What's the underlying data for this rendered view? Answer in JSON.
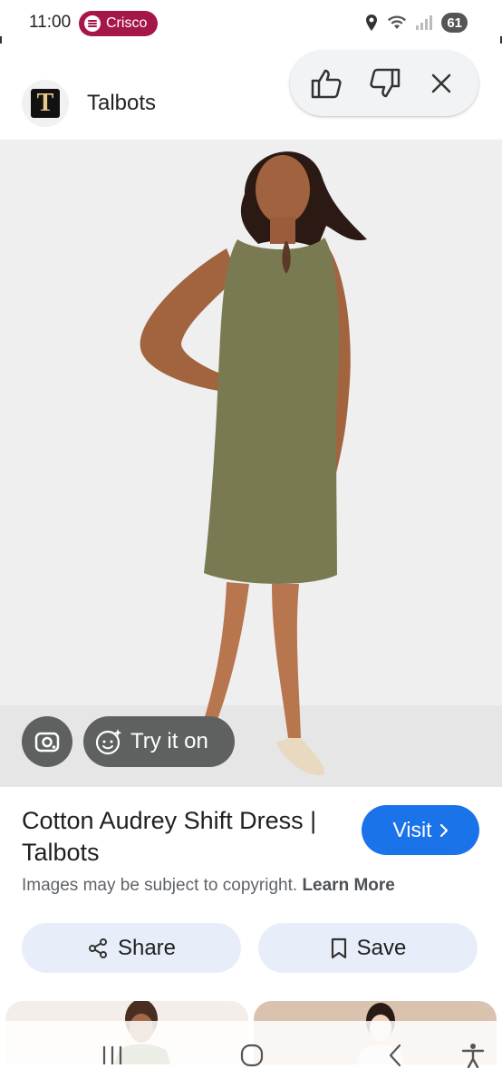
{
  "status_bar": {
    "time": "11:00",
    "media_app": "Crisco",
    "battery": "61"
  },
  "header": {
    "site_name": "Talbots",
    "logo_letter": "T"
  },
  "feedback": {
    "thumbs_up_icon": "thumbs-up-icon",
    "thumbs_down_icon": "thumbs-down-icon",
    "close_icon": "close-icon"
  },
  "image": {
    "overlay_try_on": "Try it on"
  },
  "result": {
    "title": "Cotton Audrey Shift Dress | Talbots",
    "visit_label": "Visit",
    "copyright_text": "Images may be subject to copyright.",
    "learn_more": "Learn More"
  },
  "actions": {
    "share_label": "Share",
    "save_label": "Save"
  },
  "colors": {
    "accent": "#1a73e8",
    "pill_bg": "#e8eef9",
    "spotify_pill": "#a5174b",
    "dress": "#7a7a52"
  }
}
